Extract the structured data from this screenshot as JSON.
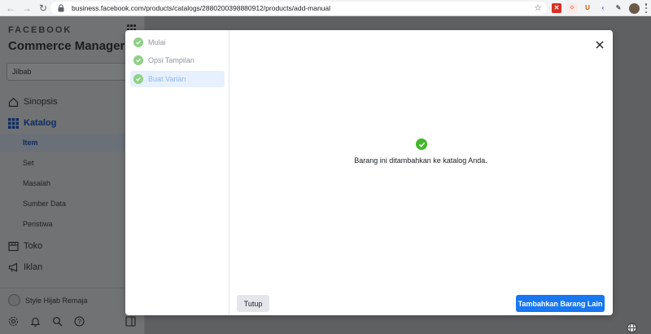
{
  "browser": {
    "url": "business.facebook.com/products/catalogs/2880200398880912/products/add-manual",
    "icons": [
      "back-icon",
      "forward-icon",
      "reload-icon",
      "lock-icon",
      "star-icon"
    ],
    "extensions": [
      {
        "name": "ext-red",
        "color": "#d93025",
        "glyph": "✕"
      },
      {
        "name": "ext-pink",
        "color": "#f4c7c3",
        "glyph": "⁘"
      },
      {
        "name": "ext-u",
        "color": "#ffffff",
        "glyph": "U"
      },
      {
        "name": "ext-purple",
        "color": "#ffffff",
        "glyph": "‹"
      },
      {
        "name": "ext-puzzle",
        "color": "#ffffff",
        "glyph": "✎"
      }
    ]
  },
  "sidebar": {
    "brand": "FACEBOOK",
    "title": "Commerce Manager",
    "selector": "Jilbab",
    "nav": {
      "sinopsis": "Sinopsis",
      "katalog": "Katalog",
      "toko": "Toko",
      "iklan": "Iklan"
    },
    "sub_items": [
      "Item",
      "Set",
      "Masalah",
      "Sumber Data",
      "Peristiwa"
    ],
    "shop_name": "Style Hijab Remaja"
  },
  "modal": {
    "steps": [
      "Mulai",
      "Opsi Tampilan",
      "Buat Varian"
    ],
    "current_step": 2,
    "success_message": "Barang ini ditambahkan ke katalog Anda.",
    "close_label": "Tutup",
    "add_label": "Tambahkan Barang Lain"
  },
  "colors": {
    "accent": "#1877f2",
    "success": "#42b72a"
  }
}
